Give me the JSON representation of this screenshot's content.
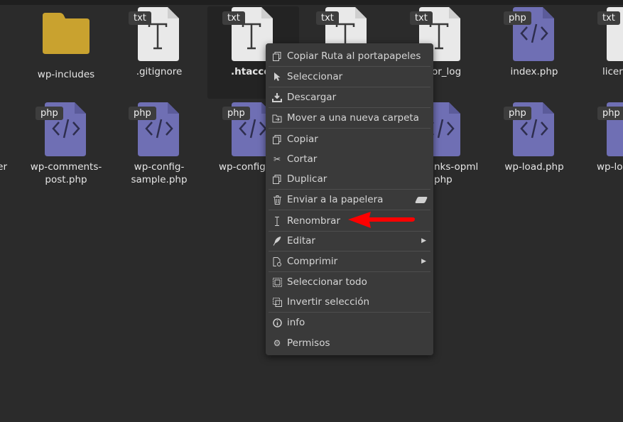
{
  "files": [
    {
      "name": "wp-includes",
      "type": "folder"
    },
    {
      "name": ".gitignore",
      "type": "txt",
      "badge": "txt"
    },
    {
      "name": ".htacce",
      "type": "txt",
      "badge": "txt"
    },
    {
      "name": "",
      "type": "txt",
      "badge": "txt"
    },
    {
      "name": "or_log",
      "type": "txt",
      "badge": "txt"
    },
    {
      "name": "index.php",
      "type": "php",
      "badge": "php"
    },
    {
      "name": "licer",
      "type": "txt",
      "badge": "txt"
    },
    {
      "name": "der",
      "type": "folder"
    },
    {
      "name": "wp-comments-post.php",
      "line1": "wp-comments-",
      "line2": "post.php",
      "type": "php",
      "badge": "php"
    },
    {
      "name": "wp-config-sample.php",
      "line1": "wp-config-",
      "line2": "sample.php",
      "type": "php",
      "badge": "php"
    },
    {
      "name": "wp-config",
      "type": "php",
      "badge": "php"
    },
    {
      "name": "nks-opml php",
      "line1": "nks-opml",
      "line2": "php",
      "type": "php",
      "badge": "php"
    },
    {
      "name": "wp-load.php",
      "type": "php",
      "badge": "php"
    },
    {
      "name": "wp-lo",
      "type": "php",
      "badge": "php"
    }
  ],
  "menu": {
    "items": [
      {
        "label": "Copiar Ruta al portapapeles",
        "icon": "copy-icon"
      },
      {
        "label": "Seleccionar",
        "icon": "cursor-icon"
      },
      {
        "label": "Descargar",
        "icon": "download-icon"
      },
      {
        "label": "Mover a una nueva carpeta",
        "icon": "move-folder-icon"
      },
      {
        "label": "Copiar",
        "icon": "copy-icon"
      },
      {
        "label": "Cortar",
        "icon": "scissors-icon"
      },
      {
        "label": "Duplicar",
        "icon": "duplicate-icon"
      },
      {
        "label": "Enviar a la papelera",
        "icon": "trash-icon"
      },
      {
        "label": "Renombrar",
        "icon": "text-cursor-icon"
      },
      {
        "label": "Editar",
        "icon": "quill-icon"
      },
      {
        "label": "Comprimir",
        "icon": "compress-icon"
      },
      {
        "label": "Seleccionar todo",
        "icon": "select-all-icon"
      },
      {
        "label": "Invertir selección",
        "icon": "invert-selection-icon"
      },
      {
        "label": "info",
        "icon": "info-icon"
      },
      {
        "label": "Permisos",
        "icon": "gear-icon"
      }
    ]
  },
  "colors": {
    "background": "#2b2b2b",
    "folder": "#c9a22f",
    "txt_file": "#e9e9e9",
    "php_file": "#6f6fb4",
    "menu_bg": "#3a3a3a",
    "arrow": "#ff0000"
  }
}
